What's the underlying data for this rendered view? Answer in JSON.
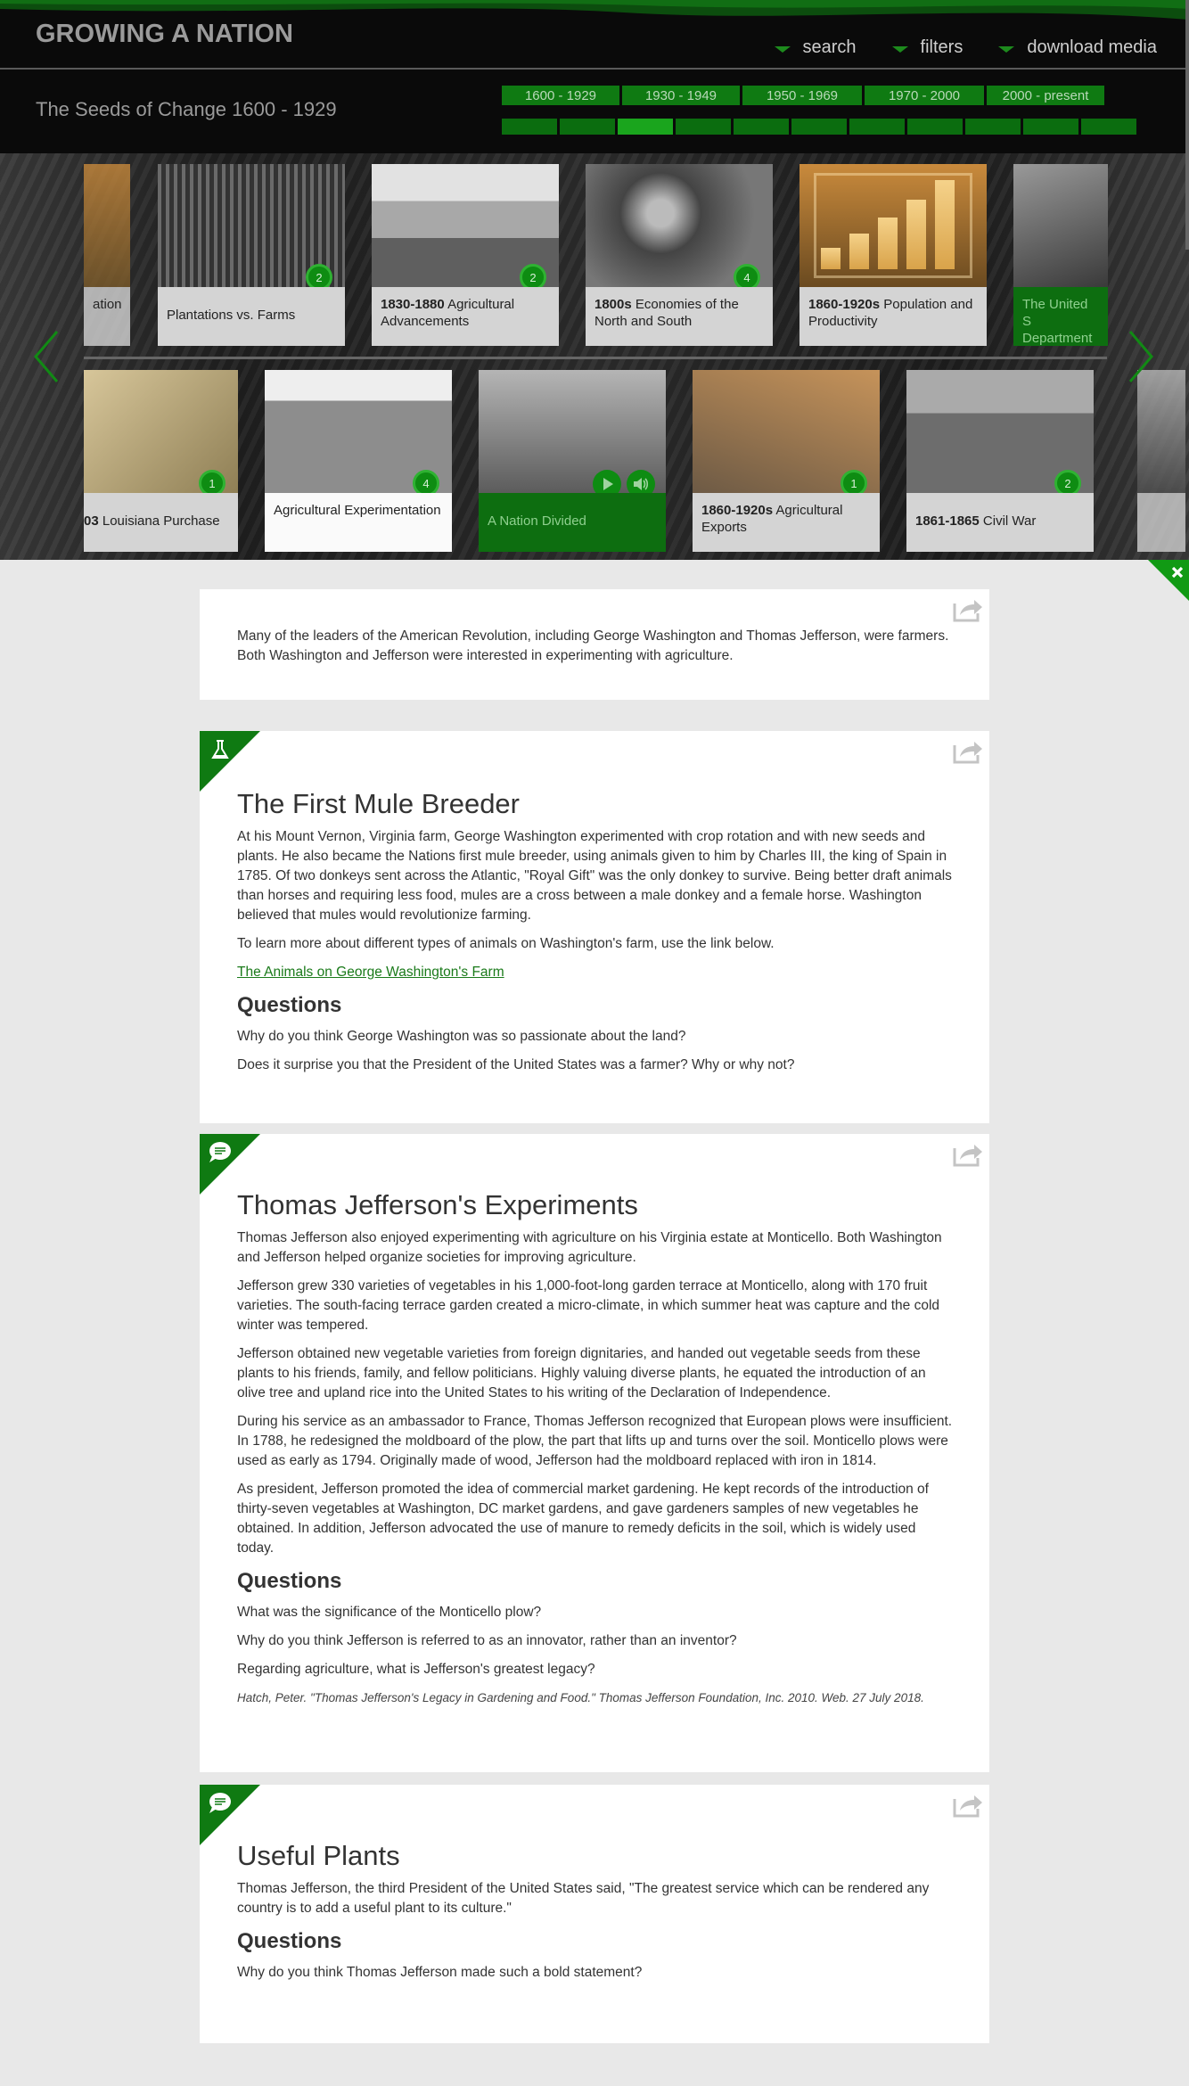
{
  "header": {
    "brand": "GROWING A NATION",
    "nav": [
      {
        "label": "search"
      },
      {
        "label": "filters"
      },
      {
        "label": "download media"
      }
    ],
    "era_title": "The Seeds of Change  1600 - 1929",
    "era_tabs": [
      "1600 - 1929",
      "1930 - 1949",
      "1950 - 1969",
      "1970 - 2000",
      "2000 - present"
    ],
    "tick_count": 11,
    "active_tick": 2
  },
  "carousel_top": [
    {
      "label": "ation",
      "bold": "",
      "count": ""
    },
    {
      "label": "Plantations vs. Farms",
      "bold": "",
      "count": "2"
    },
    {
      "label": "Agricultural Advancements",
      "bold": "1830-1880",
      "count": "2"
    },
    {
      "label": "Economies of the North and South",
      "bold": "1800s",
      "count": "4"
    },
    {
      "label": "Population and Productivity",
      "bold": "1860-1920s",
      "count": ""
    },
    {
      "label": "The United S Department",
      "bold": "",
      "count": ""
    }
  ],
  "carousel_bottom": [
    {
      "label": "Louisiana Purchase",
      "bold": "03",
      "count": "1"
    },
    {
      "label": "Agricultural Experimentation",
      "bold": "",
      "count": "4"
    },
    {
      "label": "A Nation Divided",
      "bold": "",
      "count": ""
    },
    {
      "label": "Agricultural Exports",
      "bold": "1860-1920s",
      "count": "1"
    },
    {
      "label": "Civil War",
      "bold": "1861-1865",
      "count": "2"
    }
  ],
  "intro": {
    "text": "Many of the leaders of the American Revolution, including George Washington and Thomas Jefferson, were farmers. Both Washington and Jefferson were interested in experimenting with agriculture."
  },
  "mule": {
    "title": "The First Mule Breeder",
    "p1": "At his Mount Vernon, Virginia farm, George Washington experimented with crop rotation and with new seeds and plants. He also became the Nations first mule breeder, using animals given to him by Charles III, the king of Spain in 1785. Of two donkeys sent across the Atlantic, \"Royal Gift\" was the only donkey to survive. Being better draft animals than horses and requiring less food, mules are a cross between a male donkey and a female horse. Washington believed that mules would revolutionize farming.",
    "p2": "To learn more about different types of animals on Washington's farm, use the link below.",
    "link": "The Animals on George Washington's Farm",
    "questions_heading": "Questions",
    "q1": "Why do you think George Washington was so passionate about the land?",
    "q2": "Does it surprise you that the President of the United States was a farmer? Why or why not?"
  },
  "jefferson": {
    "title": "Thomas Jefferson's Experiments",
    "p1": "Thomas Jefferson also enjoyed experimenting with agriculture on his Virginia estate at Monticello. Both Washington and Jefferson helped organize societies for improving agriculture.",
    "p2": "Jefferson grew 330 varieties of vegetables in his 1,000-foot-long garden terrace at Monticello, along with 170 fruit varieties. The south-facing terrace garden created a micro-climate, in which summer heat was capture and the cold winter was tempered.",
    "p3": "Jefferson obtained new vegetable varieties from foreign dignitaries, and handed out vegetable seeds from these plants to his friends, family, and fellow politicians. Highly valuing diverse plants, he equated the introduction of an olive tree and upland rice into the United States to his writing of the Declaration of Independence.",
    "p4": "During his service as an ambassador to France, Thomas Jefferson recognized that European plows were insufficient. In 1788, he redesigned the moldboard of the plow, the part that lifts up and turns over the soil. Monticello plows were used as early as 1794. Originally made of wood, Jefferson had the moldboard replaced with iron in 1814.",
    "p5": "As president, Jefferson promoted the idea of commercial market gardening. He kept records of the introduction of thirty-seven vegetables at Washington, DC market gardens, and gave gardeners samples of new vegetables he obtained. In addition, Jefferson advocated the use of manure to remedy deficits in the soil, which is widely used today.",
    "questions_heading": "Questions",
    "q1": "What was the significance of the Monticello plow?",
    "q2": "Why do you think Jefferson is referred to as an innovator, rather than an inventor?",
    "q3": "Regarding agriculture, what is Jefferson's greatest legacy?",
    "citation": "Hatch, Peter. \"Thomas Jefferson's Legacy in Gardening and Food.\" Thomas Jefferson Foundation, Inc. 2010. Web. 27 July 2018."
  },
  "plants": {
    "title": "Useful Plants",
    "p1": "Thomas Jefferson, the third President of the United States said, \"The greatest service which can be rendered any country is to add a useful plant to its culture.\"",
    "questions_heading": "Questions",
    "q1": "Why do you think Thomas Jefferson made such a bold statement?"
  },
  "colors": {
    "accent": "#0f7a12",
    "bright": "#1aa51d",
    "dark_bg": "#0a0a0a",
    "content_bg": "#e8e8e8"
  }
}
